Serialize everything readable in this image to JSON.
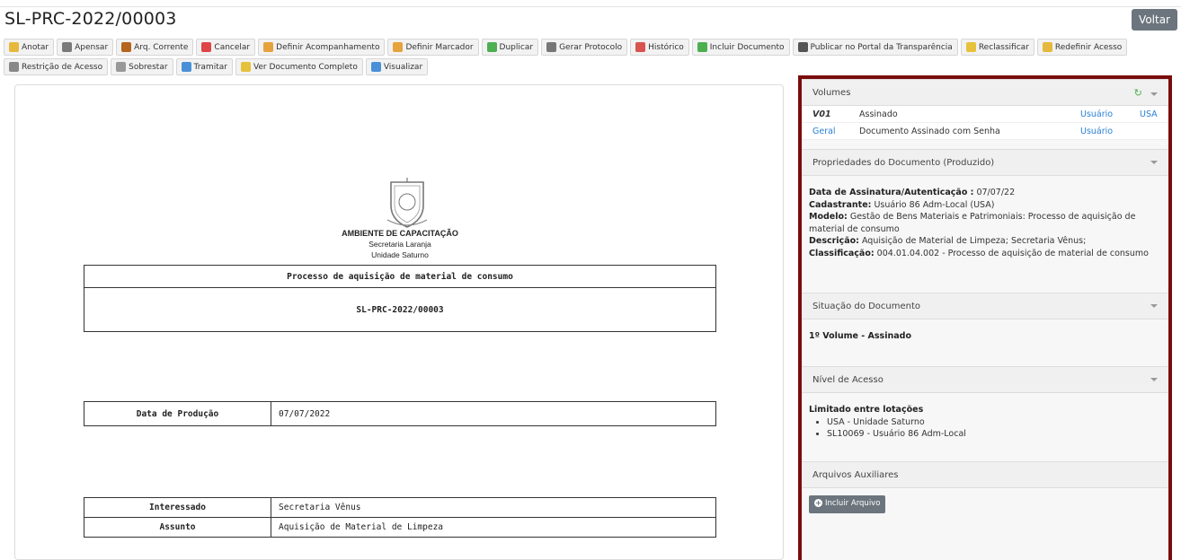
{
  "page": {
    "title": "SL-PRC-2022/00003",
    "back_label": "Voltar"
  },
  "toolbar": [
    {
      "label": "Anotar",
      "icon": "note-icon",
      "color": "#e6b93c"
    },
    {
      "label": "Apensar",
      "icon": "clip-icon",
      "color": "#7a7a7a"
    },
    {
      "label": "Arq. Corrente",
      "icon": "archive-icon",
      "color": "#b5651d"
    },
    {
      "label": "Cancelar",
      "icon": "cancel-icon",
      "color": "#e04545"
    },
    {
      "label": "Definir Acompanhamento",
      "icon": "folder-icon",
      "color": "#e6a23c"
    },
    {
      "label": "Definir Marcador",
      "icon": "folder-tag-icon",
      "color": "#e6a23c"
    },
    {
      "label": "Duplicar",
      "icon": "duplicate-icon",
      "color": "#4caf50"
    },
    {
      "label": "Gerar Protocolo",
      "icon": "printer-icon",
      "color": "#777"
    },
    {
      "label": "Histórico",
      "icon": "calendar-icon",
      "color": "#d9534f"
    },
    {
      "label": "Incluir Documento",
      "icon": "add-document-icon",
      "color": "#4caf50"
    },
    {
      "label": "Publicar no Portal da Transparência",
      "icon": "publish-icon",
      "color": "#555"
    },
    {
      "label": "Reclassificar",
      "icon": "reclassify-icon",
      "color": "#e6c23c"
    },
    {
      "label": "Redefinir Acesso",
      "icon": "shield-icon",
      "color": "#e6b93c"
    },
    {
      "label": "Restrição de Acesso",
      "icon": "lock-icon",
      "color": "#888"
    },
    {
      "label": "Sobrestar",
      "icon": "pause-icon",
      "color": "#999"
    },
    {
      "label": "Tramitar",
      "icon": "forward-icon",
      "color": "#4a90d9"
    },
    {
      "label": "Ver Documento Completo",
      "icon": "folder-open-icon",
      "color": "#e6c23c"
    },
    {
      "label": "Visualizar",
      "icon": "eye-icon",
      "color": "#4a90d9"
    }
  ],
  "document": {
    "org_line1": "AMBIENTE DE CAPACITAÇÃO",
    "org_line2": "Secretaria Laranja",
    "org_line3": "Unidade Saturno",
    "heading": "Processo de aquisição de material de consumo",
    "number": "SL-PRC-2022/00003",
    "production_label": "Data de Produção",
    "production_value": "07/07/2022",
    "interested_label": "Interessado",
    "interested_value": "Secretaria Vênus",
    "subject_label": "Assunto",
    "subject_value": "Aquisição de Material de Limpeza"
  },
  "sidebar": {
    "volumes_title": "Volumes",
    "volumes": [
      {
        "col1": "V01",
        "col2": "Assinado",
        "col3": "Usuário",
        "col4": "USA"
      },
      {
        "col1": "Geral",
        "col2": "Documento Assinado com Senha",
        "col3": "Usuário",
        "col4": ""
      }
    ],
    "properties_title": "Propriedades do Documento (Produzido)",
    "prop_sign_label": "Data de Assinatura/Autenticação :",
    "prop_sign_value": " 07/07/22",
    "prop_reg_label": "Cadastrante:",
    "prop_reg_value": " Usuário 86 Adm-Local (USA)",
    "prop_model_label": "Modelo:",
    "prop_model_value": " Gestão de Bens Materiais e Patrimoniais: Processo de aquisição de material de consumo",
    "prop_desc_label": "Descrição:",
    "prop_desc_value": " Aquisição de Material de Limpeza; Secretaria Vênus;",
    "prop_class_label": "Classificação:",
    "prop_class_value": " 004.01.04.002 - Processo de aquisição de material de consumo",
    "situation_title": "Situação do Documento",
    "situation_value": "1º Volume - Assinado",
    "access_title": "Nível de Acesso",
    "access_heading": "Limitado entre lotações",
    "access_items": [
      "USA - Unidade Saturno",
      "SL10069 - Usuário 86 Adm-Local"
    ],
    "aux_title": "Arquivos Auxiliares",
    "aux_button": "Incluir Arquivo"
  }
}
